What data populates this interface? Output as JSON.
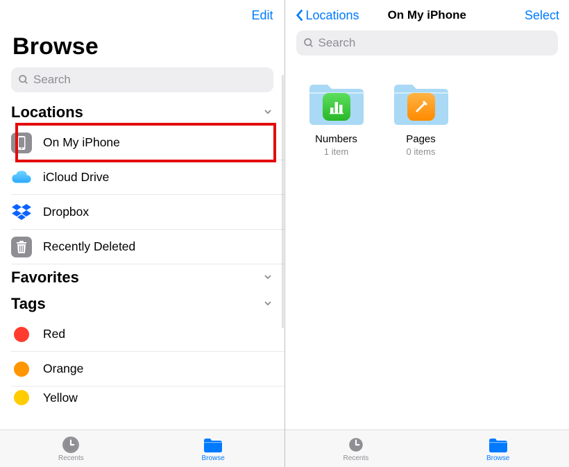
{
  "left": {
    "edit": "Edit",
    "title": "Browse",
    "search_placeholder": "Search",
    "sections": {
      "locations": "Locations",
      "favorites": "Favorites",
      "tags": "Tags"
    },
    "locations": [
      {
        "name": "On My iPhone"
      },
      {
        "name": "iCloud Drive"
      },
      {
        "name": "Dropbox"
      },
      {
        "name": "Recently Deleted"
      }
    ],
    "tags": [
      {
        "name": "Red",
        "color": "#ff3b30"
      },
      {
        "name": "Orange",
        "color": "#ff9500"
      },
      {
        "name": "Yellow",
        "color": "#ffcc00"
      }
    ]
  },
  "right": {
    "back": "Locations",
    "title": "On My iPhone",
    "select": "Select",
    "search_placeholder": "Search",
    "folders": [
      {
        "name": "Numbers",
        "sub": "1 item",
        "app_color": "#39cc46",
        "app": "numbers"
      },
      {
        "name": "Pages",
        "sub": "0 items",
        "app_color": "#ff9500",
        "app": "pages"
      }
    ]
  },
  "tabs": {
    "recents": "Recents",
    "browse": "Browse"
  }
}
